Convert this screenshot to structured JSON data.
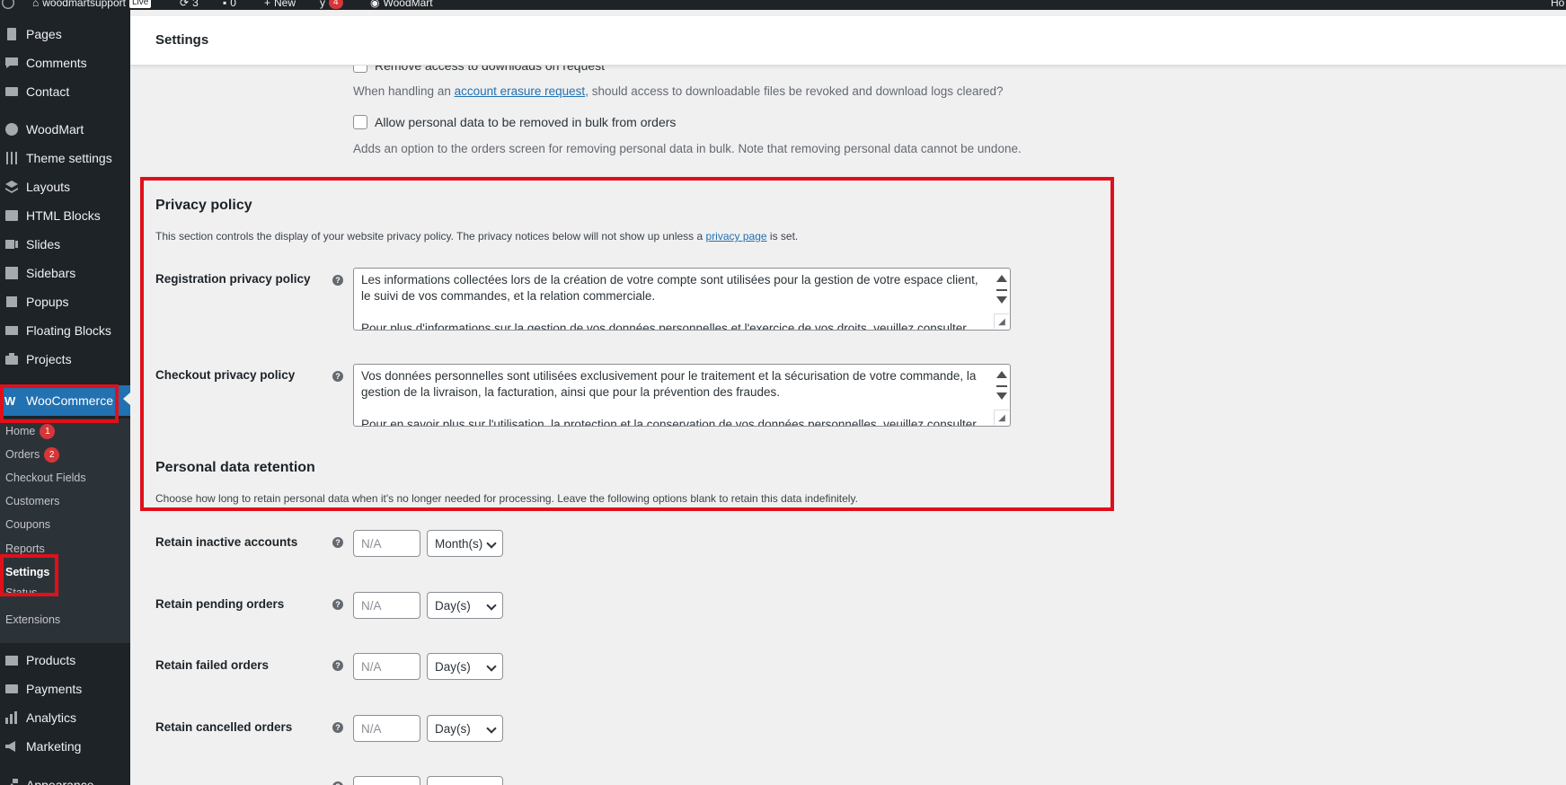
{
  "admin_bar": {
    "site_name": "woodmartsupport",
    "live_badge": "Live",
    "updates_count": "3",
    "comments_count": "0",
    "new_label": "New",
    "yoast_count": "4",
    "theme_label": "WoodMart",
    "howdy": "Ho"
  },
  "sidebar": {
    "items": [
      {
        "label": "Pages",
        "icon": "pages-icon"
      },
      {
        "label": "Comments",
        "icon": "comments-icon"
      },
      {
        "label": "Contact",
        "icon": "contact-icon"
      },
      {
        "label": "WoodMart",
        "icon": "woodmart-icon"
      },
      {
        "label": "Theme settings",
        "icon": "sliders-icon"
      },
      {
        "label": "Layouts",
        "icon": "layers-icon"
      },
      {
        "label": "HTML Blocks",
        "icon": "html-icon"
      },
      {
        "label": "Slides",
        "icon": "slides-icon"
      },
      {
        "label": "Sidebars",
        "icon": "sidebars-icon"
      },
      {
        "label": "Popups",
        "icon": "popups-icon"
      },
      {
        "label": "Floating Blocks",
        "icon": "floating-icon"
      },
      {
        "label": "Projects",
        "icon": "projects-icon"
      },
      {
        "label": "WooCommerce",
        "icon": "woocommerce-icon"
      }
    ],
    "woocommerce_submenu": [
      {
        "label": "Home",
        "count": "1"
      },
      {
        "label": "Orders",
        "count": "2"
      },
      {
        "label": "Checkout Fields"
      },
      {
        "label": "Customers"
      },
      {
        "label": "Coupons"
      },
      {
        "label": "Reports"
      },
      {
        "label": "Settings"
      },
      {
        "label": "Status"
      },
      {
        "label": "Extensions"
      }
    ],
    "bottom_items": [
      {
        "label": "Products",
        "icon": "products-icon"
      },
      {
        "label": "Payments",
        "icon": "payments-icon"
      },
      {
        "label": "Analytics",
        "icon": "analytics-icon"
      },
      {
        "label": "Marketing",
        "icon": "marketing-icon"
      },
      {
        "label": "Appearance",
        "icon": "appearance-icon"
      }
    ]
  },
  "header": {
    "title": "Settings"
  },
  "accounts": {
    "remove_downloads_label": "Remove access to downloads on request",
    "erasure_desc_before": "When handling an ",
    "erasure_link": "account erasure request",
    "erasure_desc_after": ", should access to downloadable files be revoked and download logs cleared?",
    "bulk_remove_label": "Allow personal data to be removed in bulk from orders",
    "bulk_remove_desc": "Adds an option to the orders screen for removing personal data in bulk. Note that removing personal data cannot be undone."
  },
  "privacy_policy": {
    "title": "Privacy policy",
    "desc_before": "This section controls the display of your website privacy policy. The privacy notices below will not show up unless a ",
    "desc_link": "privacy page",
    "desc_after": " is set.",
    "registration_label": "Registration privacy policy",
    "registration_p1": "Les informations collectées lors de la création de votre compte sont utilisées pour la gestion de votre espace client, le suivi de vos commandes, et la relation commerciale.",
    "registration_p2": "Pour plus d'informations sur la gestion de vos données personnelles et l'exercice de vos droits, veuillez consulter notre",
    "checkout_label": "Checkout privacy policy",
    "checkout_p1": "Vos données personnelles sont utilisées exclusivement pour le traitement et la sécurisation de votre commande, la gestion de la livraison, la facturation, ainsi que pour la prévention des fraudes.",
    "checkout_p2": "Pour en savoir plus sur l'utilisation, la protection et la conservation de vos données personnelles, veuillez consulter notre"
  },
  "retention": {
    "title": "Personal data retention",
    "desc": "Choose how long to retain personal data when it's no longer needed for processing. Leave the following options blank to retain this data indefinitely.",
    "rows": [
      {
        "label": "Retain inactive accounts",
        "placeholder": "N/A",
        "unit": "Month(s)"
      },
      {
        "label": "Retain pending orders",
        "placeholder": "N/A",
        "unit": "Day(s)"
      },
      {
        "label": "Retain failed orders",
        "placeholder": "N/A",
        "unit": "Day(s)"
      },
      {
        "label": "Retain cancelled orders",
        "placeholder": "N/A",
        "unit": "Day(s)"
      }
    ]
  },
  "help_glyph": "?",
  "colors": {
    "admin_dark": "#1d2327",
    "accent_blue": "#2271b1",
    "highlight_red": "#e0101a",
    "badge_red": "#d63638"
  }
}
